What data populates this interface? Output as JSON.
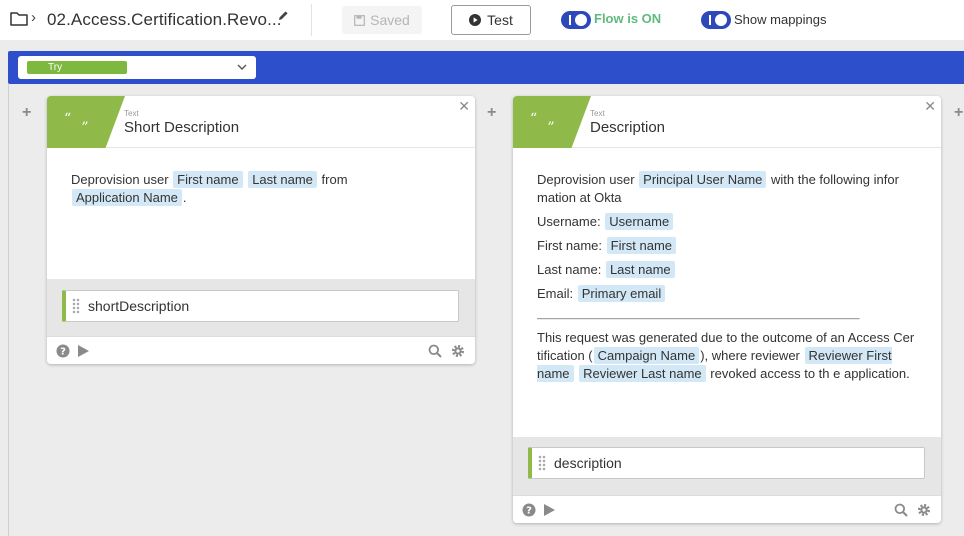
{
  "toolbar": {
    "flow_title": "02.Access.Certification.Revo...",
    "saved_label": "Saved",
    "test_label": "Test",
    "flow_status": "Flow is ON",
    "show_mappings_label": "Show mappings"
  },
  "try_select": {
    "selected": "Try"
  },
  "cards": [
    {
      "type_label": "Text",
      "title": "Short Description",
      "body": {
        "t1": "Deprovision user",
        "tok_first": "First name",
        "tok_last": "Last name",
        "t2": "from",
        "tok_app": "Application Name",
        "t3": "."
      },
      "output_var": "shortDescription"
    },
    {
      "type_label": "Text",
      "title": "Description",
      "body": {
        "t1": "Deprovision user",
        "tok_principal": "Principal User Name",
        "t2": "with the following infor mation at Okta",
        "username_label": "Username:",
        "tok_username": "Username",
        "first_label": "First name:",
        "tok_first": "First name",
        "last_label": "Last name:",
        "tok_last": "Last name",
        "email_label": "Email:",
        "tok_email": "Primary email",
        "dashes": "__________________________________________________________",
        "t3": "This request was generated due to the outcome of an Access Cer tification (",
        "tok_campaign": "Campaign Name",
        "t4": "), where reviewer",
        "tok_rev_first": "Reviewer First name",
        "tok_rev_last": "Reviewer Last name",
        "t5": "revoked access to th e application."
      },
      "output_var": "description"
    }
  ],
  "colors": {
    "accent_blue": "#2d4fcc",
    "card_green": "#8fba4a",
    "token_bg": "#d3e8f6",
    "flow_on_green": "#5fba7d"
  },
  "icons": [
    "folder-icon",
    "chevron-right-icon",
    "pencil-icon",
    "save-icon",
    "play-icon",
    "close-icon",
    "plus-icon",
    "help-icon",
    "search-icon",
    "gear-icon",
    "chevron-down-icon",
    "drag-handle-icon",
    "quote-icon"
  ]
}
